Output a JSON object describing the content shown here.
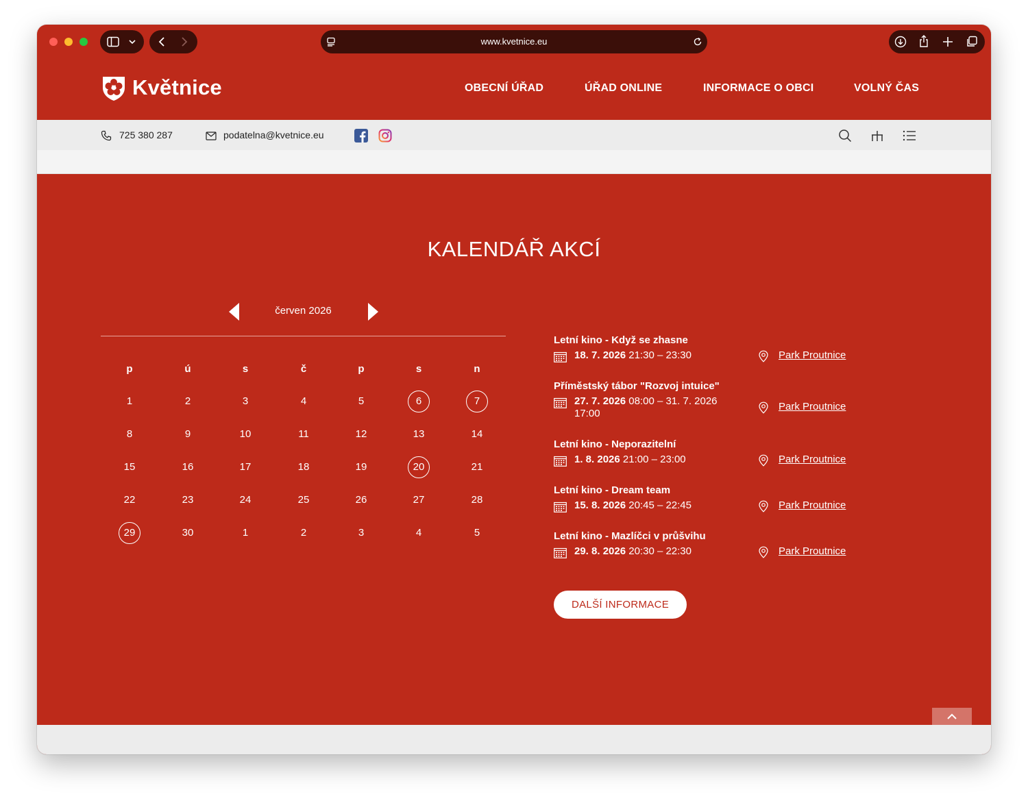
{
  "browser": {
    "url": "www.kvetnice.eu"
  },
  "site": {
    "logo_text": "Květnice",
    "nav": [
      {
        "label": "OBECNÍ ÚŘAD"
      },
      {
        "label": "ÚŘAD ONLINE"
      },
      {
        "label": "INFORMACE O OBCI"
      },
      {
        "label": "VOLNÝ ČAS"
      }
    ]
  },
  "contact": {
    "phone": "725 380 287",
    "email": "podatelna@kvetnice.eu"
  },
  "calendar": {
    "title": "KALENDÁŘ AKCÍ",
    "month": "červen 2026",
    "weekdays": [
      "p",
      "ú",
      "s",
      "č",
      "p",
      "s",
      "n"
    ],
    "weeks": [
      [
        {
          "d": "1"
        },
        {
          "d": "2"
        },
        {
          "d": "3"
        },
        {
          "d": "4"
        },
        {
          "d": "5"
        },
        {
          "d": "6",
          "ring": true
        },
        {
          "d": "7",
          "ring": true
        }
      ],
      [
        {
          "d": "8"
        },
        {
          "d": "9"
        },
        {
          "d": "10"
        },
        {
          "d": "11"
        },
        {
          "d": "12"
        },
        {
          "d": "13"
        },
        {
          "d": "14"
        }
      ],
      [
        {
          "d": "15"
        },
        {
          "d": "16"
        },
        {
          "d": "17"
        },
        {
          "d": "18"
        },
        {
          "d": "19"
        },
        {
          "d": "20",
          "ring": true
        },
        {
          "d": "21"
        }
      ],
      [
        {
          "d": "22"
        },
        {
          "d": "23"
        },
        {
          "d": "24"
        },
        {
          "d": "25"
        },
        {
          "d": "26"
        },
        {
          "d": "27"
        },
        {
          "d": "28"
        }
      ],
      [
        {
          "d": "29",
          "ring": true
        },
        {
          "d": "30"
        },
        {
          "d": "1"
        },
        {
          "d": "2"
        },
        {
          "d": "3"
        },
        {
          "d": "4"
        },
        {
          "d": "5"
        }
      ]
    ]
  },
  "events": [
    {
      "title": "Letní kino - Když se zhasne",
      "date": "18. 7. 2026",
      "time": " 21:30 – 23:30",
      "place": "Park Proutnice"
    },
    {
      "title": "Příměstský tábor \"Rozvoj intuice\"",
      "date": "27. 7. 2026",
      "time": " 08:00 – 31. 7. 2026 17:00",
      "place": "Park Proutnice"
    },
    {
      "title": "Letní kino - Neporazitelní",
      "date": "1. 8. 2026",
      "time": " 21:00 – 23:00",
      "place": "Park Proutnice"
    },
    {
      "title": "Letní kino - Dream team",
      "date": "15. 8. 2026",
      "time": " 20:45 – 22:45",
      "place": "Park Proutnice"
    },
    {
      "title": "Letní kino - Mazlíčci v průšvihu",
      "date": "29. 8. 2026",
      "time": " 20:30 – 22:30",
      "place": "Park Proutnice"
    }
  ],
  "more_button": "DALŠÍ INFORMACE",
  "colors": {
    "brand_red": "#bd2a1a",
    "chrome_pill": "#3b0f09",
    "info_bar": "#ececec"
  }
}
